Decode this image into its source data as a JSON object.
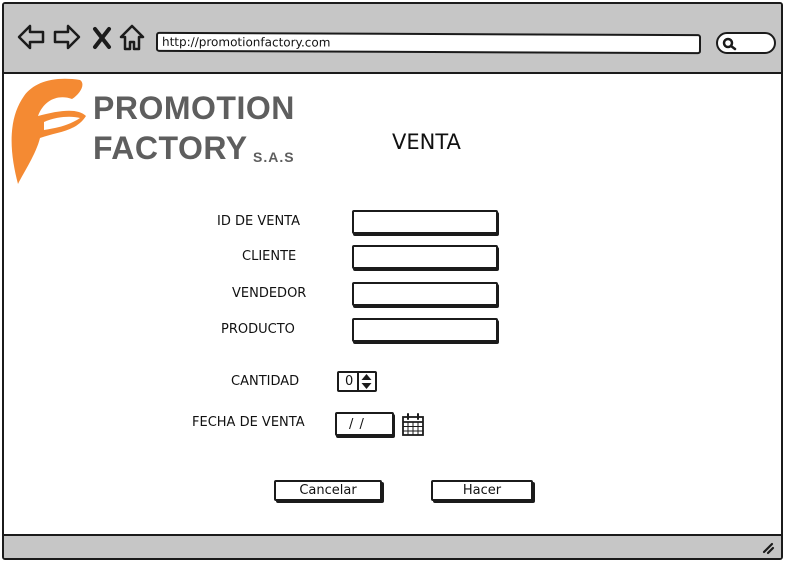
{
  "browser": {
    "url": "http://promotionfactory.com"
  },
  "logo": {
    "line1": "PROMOTION",
    "line2": "FACTORY",
    "suffix": "S.A.S",
    "accent_color": "#f48a33",
    "text_color": "#5e5e5e"
  },
  "page": {
    "title": "VENTA"
  },
  "form": {
    "id_label": "ID DE VENTA",
    "cliente_label": "CLIENTE",
    "vendedor_label": "VENDEDOR",
    "producto_label": "PRODUCTO",
    "cantidad_label": "CANTIDAD",
    "cantidad_value": "0",
    "fecha_label": "FECHA DE VENTA",
    "fecha_value": "/ /"
  },
  "buttons": {
    "cancel_label": "Cancelar",
    "submit_label": "Hacer"
  }
}
